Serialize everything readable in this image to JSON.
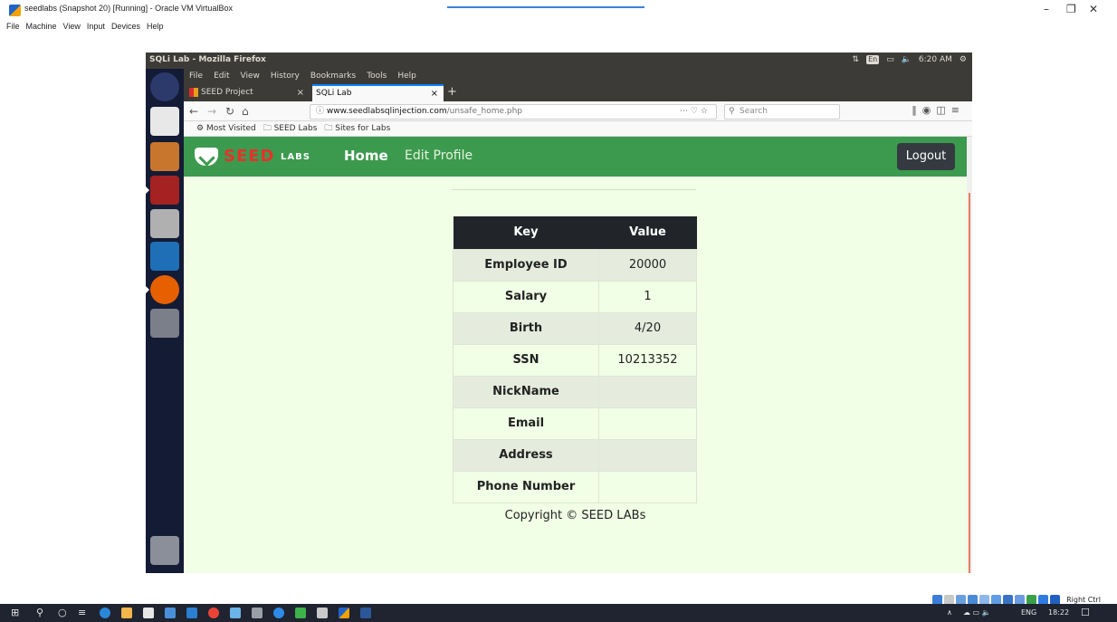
{
  "host": {
    "title": "seedlabs (Snapshot 20) [Running] - Oracle VM VirtualBox",
    "menu": [
      "File",
      "Machine",
      "View",
      "Input",
      "Devices",
      "Help"
    ],
    "right_ctrl": "Right Ctrl"
  },
  "ubuntu": {
    "window_title": "SQLi Lab - Mozilla Firefox",
    "indicator_lang": "En",
    "clock": "6:20 AM"
  },
  "firefox": {
    "menu": [
      "File",
      "Edit",
      "View",
      "History",
      "Bookmarks",
      "Tools",
      "Help"
    ],
    "tabs": [
      {
        "label": "SEED Project"
      },
      {
        "label": "SQLi Lab"
      }
    ],
    "url_host": "www.seedlabsqlinjection.com",
    "url_path": "/unsafe_home.php",
    "search_placeholder": "Search",
    "bookmarks": [
      "Most Visited",
      "SEED Labs",
      "Sites for Labs"
    ]
  },
  "page": {
    "brand_seed": "SEED",
    "brand_labs": "LABS",
    "nav_home": "Home",
    "nav_edit": "Edit Profile",
    "logout": "Logout",
    "table_header": {
      "key": "Key",
      "value": "Value"
    },
    "rows": [
      {
        "key": "Employee ID",
        "value": "20000"
      },
      {
        "key": "Salary",
        "value": "1"
      },
      {
        "key": "Birth",
        "value": "4/20"
      },
      {
        "key": "SSN",
        "value": "10213352"
      },
      {
        "key": "NickName",
        "value": ""
      },
      {
        "key": "Email",
        "value": ""
      },
      {
        "key": "Address",
        "value": ""
      },
      {
        "key": "Phone Number",
        "value": ""
      }
    ],
    "copyright": "Copyright © SEED LABs"
  },
  "taskbar": {
    "lang": "ENG",
    "time": "18:22"
  },
  "colors": {
    "navbar_green": "#3c9a4e",
    "content_bg": "#f0ffe5",
    "table_header": "#212529",
    "logout_bg": "#343a40"
  }
}
